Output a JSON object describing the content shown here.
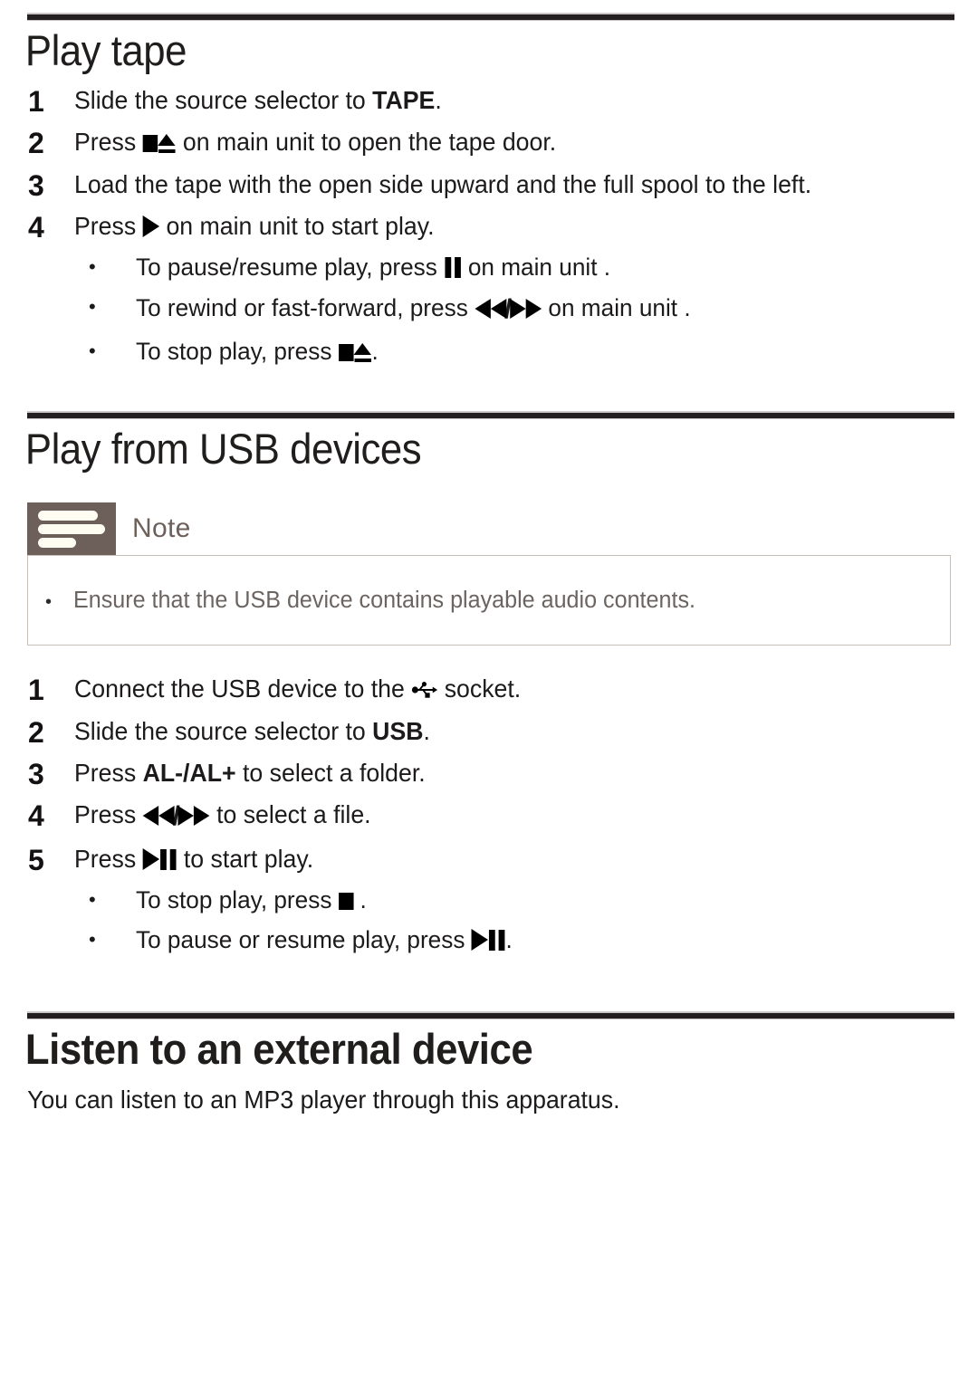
{
  "sections": [
    {
      "id": "play-tape",
      "title": "Play tape",
      "steps": [
        {
          "num": "1",
          "parts": [
            {
              "t": "text",
              "v": "Slide the source selector to "
            },
            {
              "t": "bold",
              "v": "TAPE"
            },
            {
              "t": "text",
              "v": "."
            }
          ]
        },
        {
          "num": "2",
          "parts": [
            {
              "t": "text",
              "v": "Press "
            },
            {
              "t": "icon",
              "v": "stop-icon"
            },
            {
              "t": "icon",
              "v": "eject-icon"
            },
            {
              "t": "text",
              "v": " on main unit to open the tape door."
            }
          ]
        },
        {
          "num": "3",
          "parts": [
            {
              "t": "text",
              "v": "Load the tape with the open side upward and the full spool to the left."
            }
          ]
        },
        {
          "num": "4",
          "parts": [
            {
              "t": "text",
              "v": "Press "
            },
            {
              "t": "icon",
              "v": "play-icon"
            },
            {
              "t": "text",
              "v": " on main unit to start play."
            }
          ]
        }
      ],
      "bullets": [
        {
          "bullet": "•",
          "parts": [
            {
              "t": "text",
              "v": "To pause/resume play, press "
            },
            {
              "t": "icon",
              "v": "pause-icon"
            },
            {
              "t": "text",
              "v": " on main unit ."
            }
          ]
        },
        {
          "bullet": "•",
          "parts": [
            {
              "t": "text",
              "v": "To rewind or fast-forward, press "
            },
            {
              "t": "icon",
              "v": "rewind-icon"
            },
            {
              "t": "slash",
              "v": "/"
            },
            {
              "t": "icon",
              "v": "fast-forward-icon"
            },
            {
              "t": "text",
              "v": " on main unit ."
            }
          ]
        },
        {
          "bullet": "•",
          "parts": [
            {
              "t": "text",
              "v": "To stop play, press "
            },
            {
              "t": "icon",
              "v": "stop-icon"
            },
            {
              "t": "icon",
              "v": "eject-icon"
            },
            {
              "t": "text",
              "v": "."
            }
          ]
        }
      ]
    },
    {
      "id": "play-usb",
      "title": "Play from USB devices",
      "note": {
        "label": "Note",
        "items": [
          {
            "bullet": "•",
            "text": "Ensure that the USB device contains playable audio contents."
          }
        ]
      },
      "steps": [
        {
          "num": "1",
          "parts": [
            {
              "t": "text",
              "v": "Connect the USB device to the "
            },
            {
              "t": "icon",
              "v": "usb-icon"
            },
            {
              "t": "text",
              "v": " socket."
            }
          ]
        },
        {
          "num": "2",
          "parts": [
            {
              "t": "text",
              "v": "Slide the source selector to "
            },
            {
              "t": "bold",
              "v": "USB"
            },
            {
              "t": "text",
              "v": "."
            }
          ]
        },
        {
          "num": "3",
          "parts": [
            {
              "t": "text",
              "v": "Press "
            },
            {
              "t": "bold",
              "v": "AL-/AL+"
            },
            {
              "t": "text",
              "v": " to select a folder."
            }
          ]
        },
        {
          "num": "4",
          "parts": [
            {
              "t": "text",
              "v": "Press "
            },
            {
              "t": "icon",
              "v": "rewind-icon"
            },
            {
              "t": "slash",
              "v": "/"
            },
            {
              "t": "icon",
              "v": "fast-forward-icon"
            },
            {
              "t": "text",
              "v": " to select a file."
            }
          ]
        },
        {
          "num": "5",
          "parts": [
            {
              "t": "text",
              "v": "Press "
            },
            {
              "t": "icon",
              "v": "play-icon"
            },
            {
              "t": "icon",
              "v": "pause-icon"
            },
            {
              "t": "text",
              "v": " to start play."
            }
          ]
        }
      ],
      "bullets": [
        {
          "bullet": "•",
          "parts": [
            {
              "t": "text",
              "v": "To stop play, press "
            },
            {
              "t": "icon",
              "v": "stop-icon"
            },
            {
              "t": "text",
              "v": " ."
            }
          ]
        },
        {
          "bullet": "•",
          "parts": [
            {
              "t": "text",
              "v": "To pause or resume play, press "
            },
            {
              "t": "icon",
              "v": "play-icon"
            },
            {
              "t": "icon",
              "v": "pause-icon"
            },
            {
              "t": "text",
              "v": "."
            }
          ]
        }
      ]
    },
    {
      "id": "listen-external",
      "title": "Listen to an external device",
      "paragraph": "You can listen to an MP3 player through this apparatus."
    }
  ],
  "colors": {
    "rule": "#231f20",
    "note_tab": "#6d5f59",
    "note_border": "#c9bfb6",
    "note_text": "#6b6460",
    "body_text": "#1c1a1a"
  }
}
